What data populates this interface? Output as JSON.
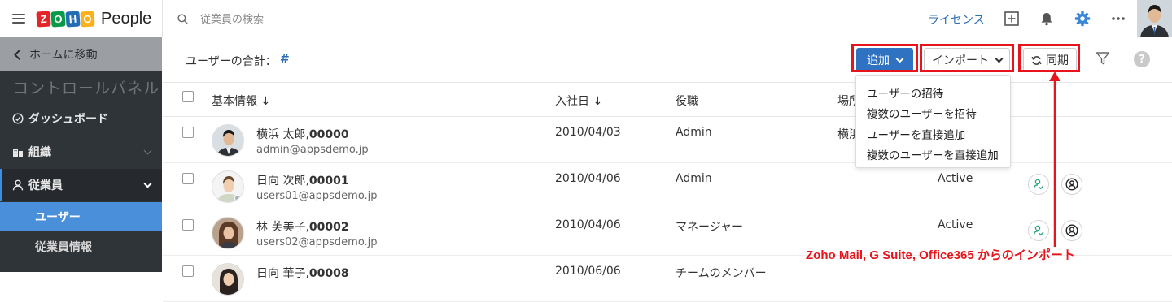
{
  "header": {
    "brand_letters": [
      "Z",
      "O",
      "H",
      "O"
    ],
    "brand_colors": [
      "#e42527",
      "#089949",
      "#226db4",
      "#f9b21d"
    ],
    "app_name": "People",
    "search_placeholder": "従業員の検索",
    "license_link": "ライセンス",
    "icons": [
      "add-square-icon",
      "bell-icon",
      "gear-icon",
      "more-icon"
    ]
  },
  "sidebar": {
    "home_link": "ホームに移動",
    "panel_title": "コントロールパネル",
    "items": [
      {
        "label": "ダッシュボード",
        "icon": "dashboard-icon"
      },
      {
        "label": "組織",
        "icon": "building-icon"
      },
      {
        "label": "従業員",
        "icon": "user-icon",
        "active": true
      }
    ],
    "sub_items": [
      {
        "label": "ユーザー",
        "selected": true
      },
      {
        "label": "従業員情報"
      }
    ]
  },
  "toolbar": {
    "total_label": "ユーザーの合計：",
    "total_count": "#",
    "add_button": "追加",
    "import_button": "インポート",
    "sync_button": "同期"
  },
  "table": {
    "columns": [
      "基本情報",
      "入社日",
      "役職",
      "場所"
    ],
    "rows": [
      {
        "name": "横浜 太郎,",
        "id": "00000",
        "email": "admin@appsdemo.jp",
        "join_date": "2010/04/03",
        "role": "Admin",
        "place": "横浜",
        "status": ""
      },
      {
        "name": "日向 次郎,",
        "id": "00001",
        "email": "users01@appsdemo.jp",
        "join_date": "2010/04/06",
        "role": "Admin",
        "place": "",
        "status": "Active"
      },
      {
        "name": "林 芙美子,",
        "id": "00002",
        "email": "users02@appsdemo.jp",
        "join_date": "2010/04/06",
        "role": "マネージャー",
        "place": "",
        "status": "Active"
      },
      {
        "name": "日向 華子,",
        "id": "00008",
        "email": "",
        "join_date": "2010/06/06",
        "role": "チームのメンバー",
        "place": "",
        "status": ""
      }
    ]
  },
  "add_menu": {
    "items": [
      "ユーザーの招待",
      "複数のユーザーを招待",
      "ユーザーを直接追加",
      "複数のユーザーを直接追加"
    ]
  },
  "annotation": {
    "text": "Zoho Mail, G Suite, Office365 からのインポート",
    "color": "#e8141b"
  },
  "colors": {
    "accent": "#2f72c2",
    "sidebar_bg": "#2f3438",
    "selected_sub_item": "#4a8fd9"
  }
}
